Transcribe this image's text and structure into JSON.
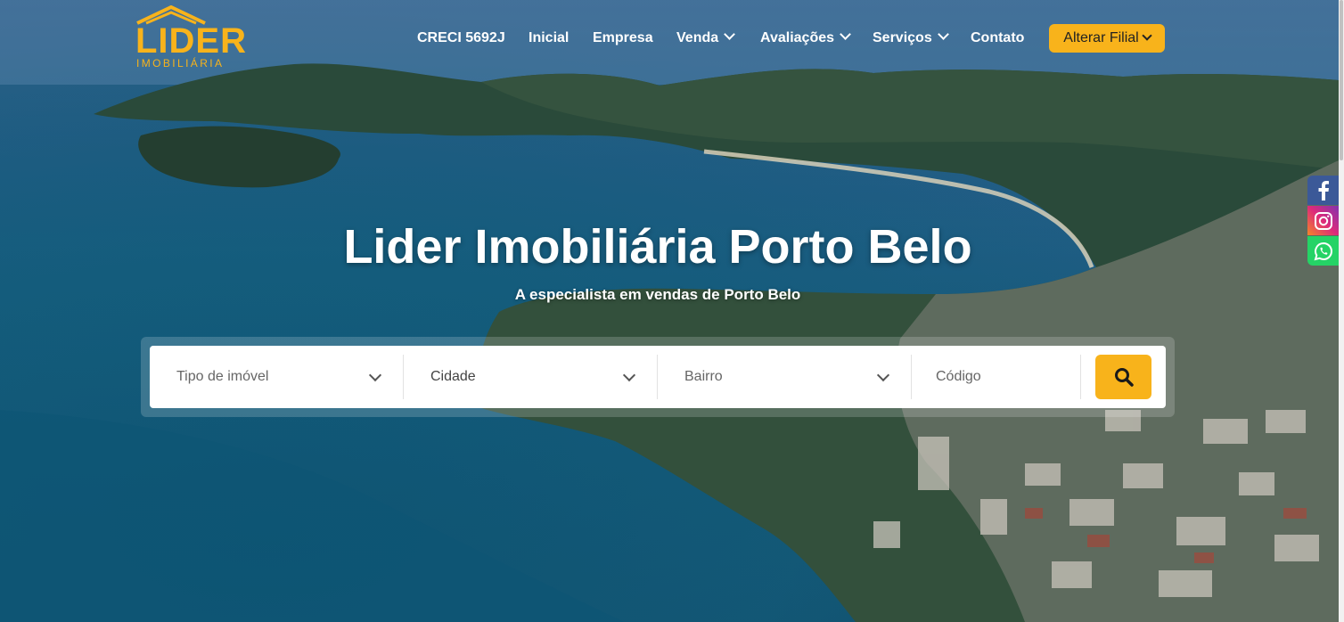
{
  "brand": {
    "name": "LIDER",
    "tagline": "IMOBILIÁRIA",
    "accent": "#f8b31b"
  },
  "nav": {
    "items": [
      {
        "label": "CRECI 5692J",
        "has_dropdown": false
      },
      {
        "label": "Inicial",
        "has_dropdown": false
      },
      {
        "label": "Empresa",
        "has_dropdown": false
      },
      {
        "label": "Venda",
        "has_dropdown": true
      },
      {
        "label": "Avaliações",
        "has_dropdown": true
      },
      {
        "label": "Serviços",
        "has_dropdown": true
      },
      {
        "label": "Contato",
        "has_dropdown": false
      }
    ],
    "branch_button": "Alterar Filial"
  },
  "hero": {
    "title": "Lider Imobiliária Porto Belo",
    "subtitle": "A especialista em vendas de Porto Belo"
  },
  "search": {
    "property_type": "Tipo de imóvel",
    "city": "Cidade",
    "neighborhood": "Bairro",
    "code_placeholder": "Código",
    "button_icon": "search-icon"
  },
  "social": [
    "facebook-icon",
    "instagram-icon",
    "whatsapp-icon"
  ]
}
